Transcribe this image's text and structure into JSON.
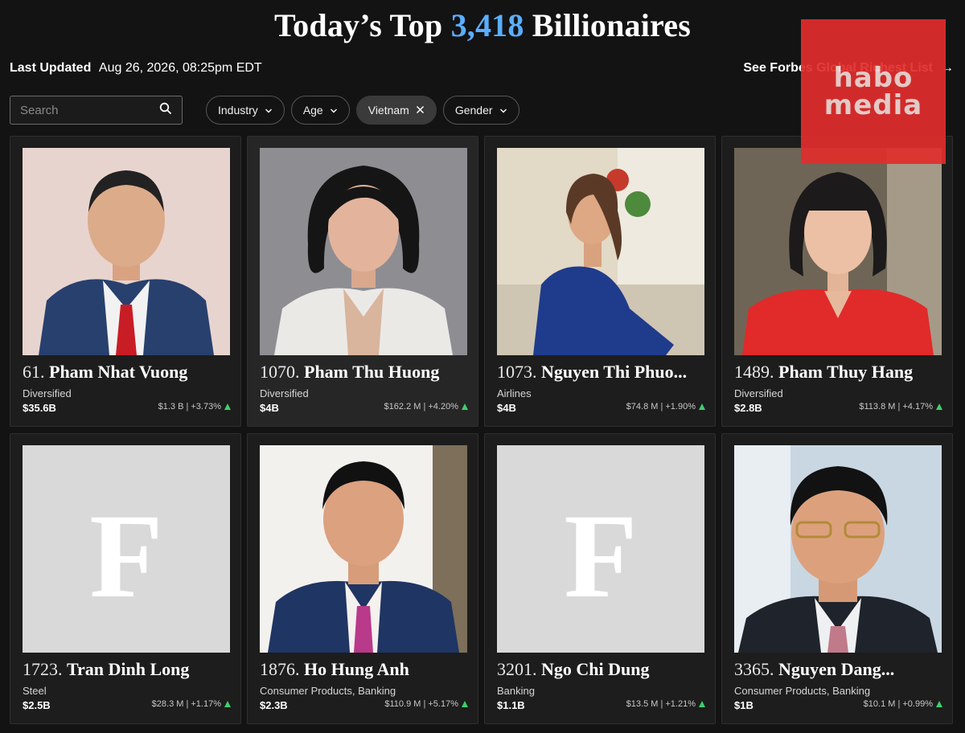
{
  "header": {
    "title_prefix": "Today’s Top",
    "title_count": "3,418",
    "title_suffix": "Billionaires",
    "updated_label": "Last Updated",
    "updated_value": "Aug 26, 2026, 08:25pm EDT",
    "see_link": "See Forbes Global Richest List",
    "arrow": "→"
  },
  "watermark": {
    "line1": "habo",
    "line2": "media"
  },
  "search": {
    "placeholder": "Search"
  },
  "filters": [
    {
      "label": "Industry",
      "icon": "chevron-down-icon"
    },
    {
      "label": "Age",
      "icon": "chevron-down-icon"
    },
    {
      "label": "Vietnam",
      "icon": "close-icon",
      "active": true
    },
    {
      "label": "Gender",
      "icon": "chevron-down-icon"
    }
  ],
  "colors": {
    "accent": "#5aaeff",
    "up": "#3ecf6b",
    "background": "#131313",
    "watermark": "#e12e2c"
  },
  "cards": [
    {
      "rank": "61.",
      "name": "Pham Nhat Vuong",
      "industry": "Diversified",
      "worth": "$35.6B",
      "change": "$1.3 B | +3.73%",
      "photo": "portrait"
    },
    {
      "rank": "1070.",
      "name": "Pham Thu Huong",
      "industry": "Diversified",
      "worth": "$4B",
      "change": "$162.2 M | +4.20%",
      "photo": "portrait"
    },
    {
      "rank": "1073.",
      "name": "Nguyen Thi Phuo...",
      "industry": "Airlines",
      "worth": "$4B",
      "change": "$74.8 M | +1.90%",
      "photo": "portrait"
    },
    {
      "rank": "1489.",
      "name": "Pham Thuy Hang",
      "industry": "Diversified",
      "worth": "$2.8B",
      "change": "$113.8 M | +4.17%",
      "photo": "portrait"
    },
    {
      "rank": "1723.",
      "name": "Tran Dinh Long",
      "industry": "Steel",
      "worth": "$2.5B",
      "change": "$28.3 M | +1.17%",
      "photo": "placeholder",
      "placeholder_letter": "F"
    },
    {
      "rank": "1876.",
      "name": "Ho Hung Anh",
      "industry": "Consumer Products, Banking",
      "worth": "$2.3B",
      "change": "$110.9 M | +5.17%",
      "photo": "portrait"
    },
    {
      "rank": "3201.",
      "name": "Ngo Chi Dung",
      "industry": "Banking",
      "worth": "$1.1B",
      "change": "$13.5 M | +1.21%",
      "photo": "placeholder",
      "placeholder_letter": "F"
    },
    {
      "rank": "3365.",
      "name": "Nguyen Dang...",
      "industry": "Consumer Products, Banking",
      "worth": "$1B",
      "change": "$10.1 M | +0.99%",
      "photo": "portrait"
    }
  ]
}
